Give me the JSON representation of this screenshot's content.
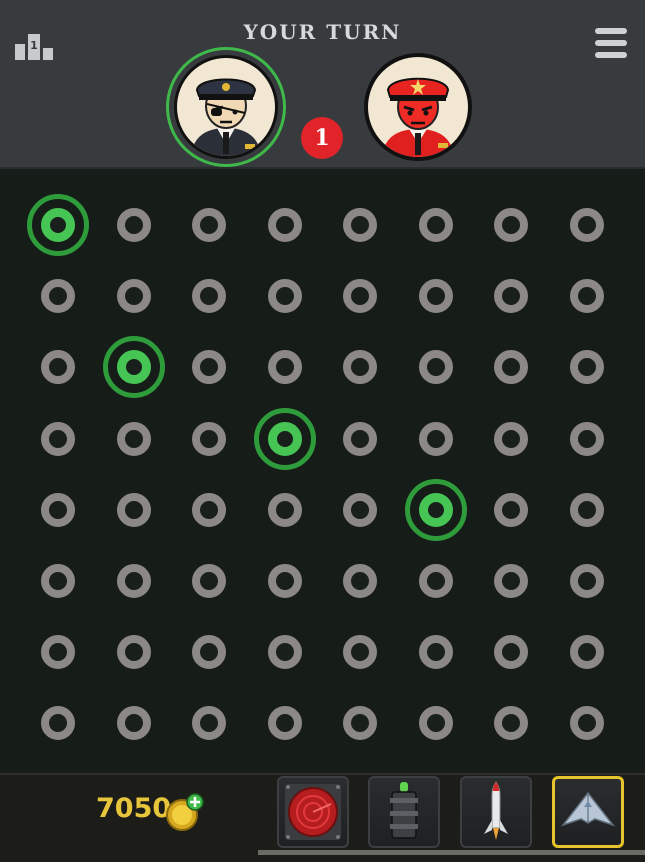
{
  "header": {
    "turn_label": "YOUR TURN",
    "turn_badge": "1",
    "player_avatar": "navy-captain-eyepatch-icon",
    "enemy_avatar": "red-general-icon",
    "rank_icon": "leaderboard-icon",
    "menu_icon": "hamburger-menu-icon"
  },
  "board": {
    "rows": 8,
    "cols": 8,
    "hits": [
      {
        "row": 1,
        "col": 1
      },
      {
        "row": 3,
        "col": 2
      },
      {
        "row": 4,
        "col": 4
      },
      {
        "row": 5,
        "col": 6
      }
    ]
  },
  "footer": {
    "coins": "7050",
    "coin_icon": "gold-coin-plus-icon",
    "tools": [
      {
        "name": "radar-sonar-icon",
        "selected": false
      },
      {
        "name": "depth-charge-icon",
        "selected": false
      },
      {
        "name": "missile-icon",
        "selected": false
      },
      {
        "name": "stealth-jet-icon",
        "selected": true
      }
    ]
  },
  "colors": {
    "header_bg": "#383b3e",
    "board_bg": "#161c17",
    "peg": "#8c8886",
    "hit": "#46c454",
    "badge": "#e0242a",
    "coins": "#e8c63c",
    "selected_tool": "#e5c42f"
  }
}
